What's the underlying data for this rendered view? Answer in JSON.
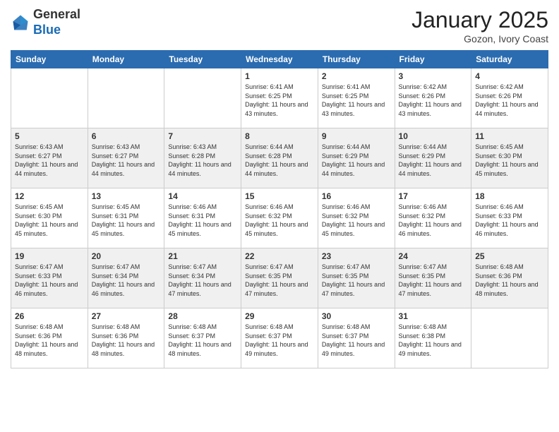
{
  "logo": {
    "general": "General",
    "blue": "Blue"
  },
  "header": {
    "month": "January 2025",
    "location": "Gozon, Ivory Coast"
  },
  "weekdays": [
    "Sunday",
    "Monday",
    "Tuesday",
    "Wednesday",
    "Thursday",
    "Friday",
    "Saturday"
  ],
  "weeks": [
    [
      {
        "day": "",
        "sunrise": "",
        "sunset": "",
        "daylight": ""
      },
      {
        "day": "",
        "sunrise": "",
        "sunset": "",
        "daylight": ""
      },
      {
        "day": "",
        "sunrise": "",
        "sunset": "",
        "daylight": ""
      },
      {
        "day": "1",
        "sunrise": "Sunrise: 6:41 AM",
        "sunset": "Sunset: 6:25 PM",
        "daylight": "Daylight: 11 hours and 43 minutes."
      },
      {
        "day": "2",
        "sunrise": "Sunrise: 6:41 AM",
        "sunset": "Sunset: 6:25 PM",
        "daylight": "Daylight: 11 hours and 43 minutes."
      },
      {
        "day": "3",
        "sunrise": "Sunrise: 6:42 AM",
        "sunset": "Sunset: 6:26 PM",
        "daylight": "Daylight: 11 hours and 43 minutes."
      },
      {
        "day": "4",
        "sunrise": "Sunrise: 6:42 AM",
        "sunset": "Sunset: 6:26 PM",
        "daylight": "Daylight: 11 hours and 44 minutes."
      }
    ],
    [
      {
        "day": "5",
        "sunrise": "Sunrise: 6:43 AM",
        "sunset": "Sunset: 6:27 PM",
        "daylight": "Daylight: 11 hours and 44 minutes."
      },
      {
        "day": "6",
        "sunrise": "Sunrise: 6:43 AM",
        "sunset": "Sunset: 6:27 PM",
        "daylight": "Daylight: 11 hours and 44 minutes."
      },
      {
        "day": "7",
        "sunrise": "Sunrise: 6:43 AM",
        "sunset": "Sunset: 6:28 PM",
        "daylight": "Daylight: 11 hours and 44 minutes."
      },
      {
        "day": "8",
        "sunrise": "Sunrise: 6:44 AM",
        "sunset": "Sunset: 6:28 PM",
        "daylight": "Daylight: 11 hours and 44 minutes."
      },
      {
        "day": "9",
        "sunrise": "Sunrise: 6:44 AM",
        "sunset": "Sunset: 6:29 PM",
        "daylight": "Daylight: 11 hours and 44 minutes."
      },
      {
        "day": "10",
        "sunrise": "Sunrise: 6:44 AM",
        "sunset": "Sunset: 6:29 PM",
        "daylight": "Daylight: 11 hours and 44 minutes."
      },
      {
        "day": "11",
        "sunrise": "Sunrise: 6:45 AM",
        "sunset": "Sunset: 6:30 PM",
        "daylight": "Daylight: 11 hours and 45 minutes."
      }
    ],
    [
      {
        "day": "12",
        "sunrise": "Sunrise: 6:45 AM",
        "sunset": "Sunset: 6:30 PM",
        "daylight": "Daylight: 11 hours and 45 minutes."
      },
      {
        "day": "13",
        "sunrise": "Sunrise: 6:45 AM",
        "sunset": "Sunset: 6:31 PM",
        "daylight": "Daylight: 11 hours and 45 minutes."
      },
      {
        "day": "14",
        "sunrise": "Sunrise: 6:46 AM",
        "sunset": "Sunset: 6:31 PM",
        "daylight": "Daylight: 11 hours and 45 minutes."
      },
      {
        "day": "15",
        "sunrise": "Sunrise: 6:46 AM",
        "sunset": "Sunset: 6:32 PM",
        "daylight": "Daylight: 11 hours and 45 minutes."
      },
      {
        "day": "16",
        "sunrise": "Sunrise: 6:46 AM",
        "sunset": "Sunset: 6:32 PM",
        "daylight": "Daylight: 11 hours and 45 minutes."
      },
      {
        "day": "17",
        "sunrise": "Sunrise: 6:46 AM",
        "sunset": "Sunset: 6:32 PM",
        "daylight": "Daylight: 11 hours and 46 minutes."
      },
      {
        "day": "18",
        "sunrise": "Sunrise: 6:46 AM",
        "sunset": "Sunset: 6:33 PM",
        "daylight": "Daylight: 11 hours and 46 minutes."
      }
    ],
    [
      {
        "day": "19",
        "sunrise": "Sunrise: 6:47 AM",
        "sunset": "Sunset: 6:33 PM",
        "daylight": "Daylight: 11 hours and 46 minutes."
      },
      {
        "day": "20",
        "sunrise": "Sunrise: 6:47 AM",
        "sunset": "Sunset: 6:34 PM",
        "daylight": "Daylight: 11 hours and 46 minutes."
      },
      {
        "day": "21",
        "sunrise": "Sunrise: 6:47 AM",
        "sunset": "Sunset: 6:34 PM",
        "daylight": "Daylight: 11 hours and 47 minutes."
      },
      {
        "day": "22",
        "sunrise": "Sunrise: 6:47 AM",
        "sunset": "Sunset: 6:35 PM",
        "daylight": "Daylight: 11 hours and 47 minutes."
      },
      {
        "day": "23",
        "sunrise": "Sunrise: 6:47 AM",
        "sunset": "Sunset: 6:35 PM",
        "daylight": "Daylight: 11 hours and 47 minutes."
      },
      {
        "day": "24",
        "sunrise": "Sunrise: 6:47 AM",
        "sunset": "Sunset: 6:35 PM",
        "daylight": "Daylight: 11 hours and 47 minutes."
      },
      {
        "day": "25",
        "sunrise": "Sunrise: 6:48 AM",
        "sunset": "Sunset: 6:36 PM",
        "daylight": "Daylight: 11 hours and 48 minutes."
      }
    ],
    [
      {
        "day": "26",
        "sunrise": "Sunrise: 6:48 AM",
        "sunset": "Sunset: 6:36 PM",
        "daylight": "Daylight: 11 hours and 48 minutes."
      },
      {
        "day": "27",
        "sunrise": "Sunrise: 6:48 AM",
        "sunset": "Sunset: 6:36 PM",
        "daylight": "Daylight: 11 hours and 48 minutes."
      },
      {
        "day": "28",
        "sunrise": "Sunrise: 6:48 AM",
        "sunset": "Sunset: 6:37 PM",
        "daylight": "Daylight: 11 hours and 48 minutes."
      },
      {
        "day": "29",
        "sunrise": "Sunrise: 6:48 AM",
        "sunset": "Sunset: 6:37 PM",
        "daylight": "Daylight: 11 hours and 49 minutes."
      },
      {
        "day": "30",
        "sunrise": "Sunrise: 6:48 AM",
        "sunset": "Sunset: 6:37 PM",
        "daylight": "Daylight: 11 hours and 49 minutes."
      },
      {
        "day": "31",
        "sunrise": "Sunrise: 6:48 AM",
        "sunset": "Sunset: 6:38 PM",
        "daylight": "Daylight: 11 hours and 49 minutes."
      },
      {
        "day": "",
        "sunrise": "",
        "sunset": "",
        "daylight": ""
      }
    ]
  ]
}
